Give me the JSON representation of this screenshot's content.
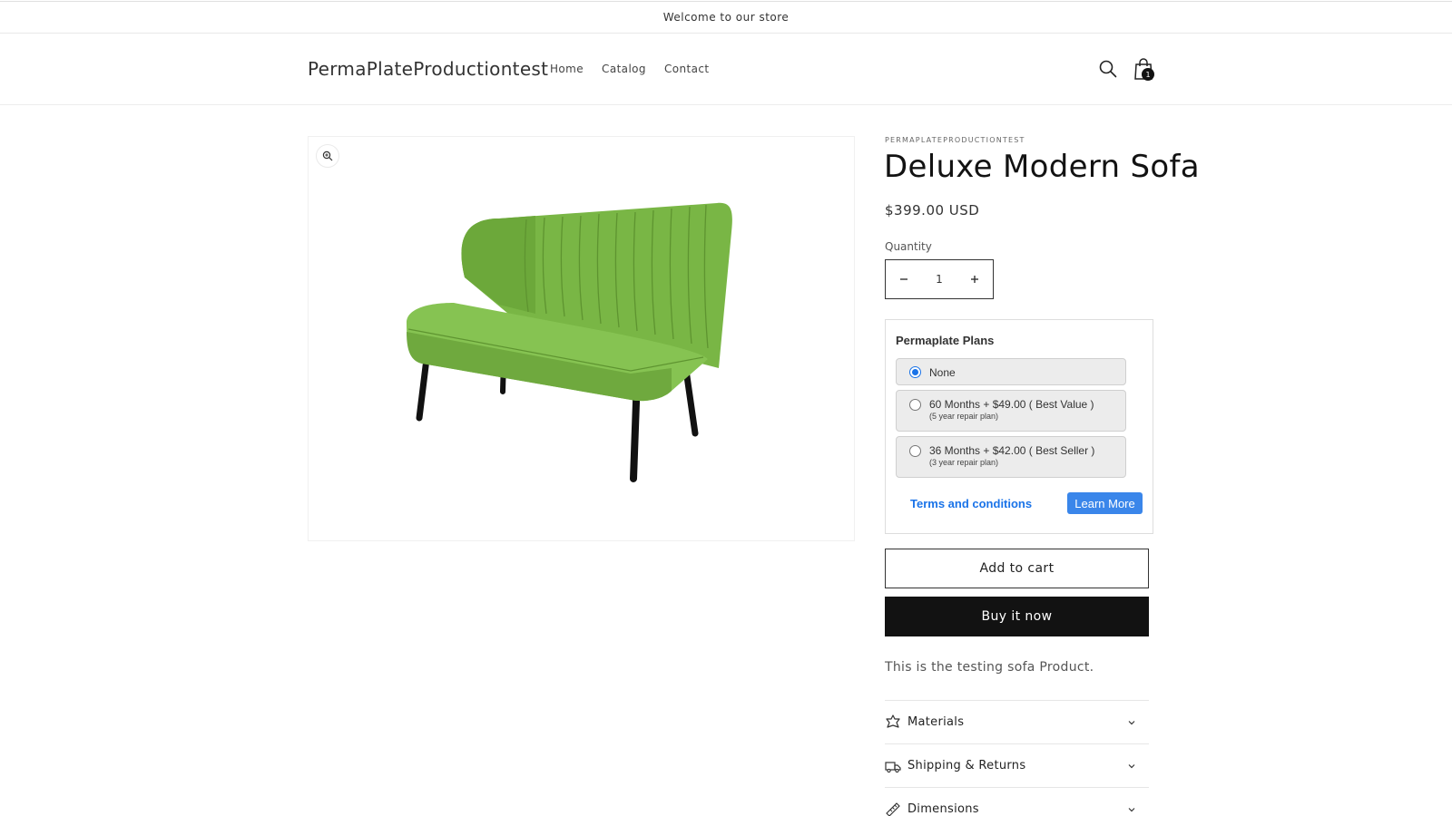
{
  "announcement": {
    "text": "Welcome to our store"
  },
  "header": {
    "logo": "PermaPlateProductiontest",
    "nav": [
      {
        "label": "Home"
      },
      {
        "label": "Catalog"
      },
      {
        "label": "Contact"
      }
    ],
    "cart_count": "1"
  },
  "product": {
    "vendor": "PERMAPLATEPRODUCTIONTEST",
    "title": "Deluxe Modern Sofa",
    "price": "$399.00 USD",
    "quantity_label": "Quantity",
    "quantity_value": "1",
    "description": "This is the testing sofa Product.",
    "image_color": "#7bb848"
  },
  "plans": {
    "title": "Permaplate Plans",
    "options": [
      {
        "label": "None",
        "sub": "",
        "selected": true
      },
      {
        "label": "60 Months + $49.00 ( Best Value )",
        "sub": "(5 year repair plan)",
        "selected": false
      },
      {
        "label": "36 Months + $42.00 ( Best Seller )",
        "sub": "(3 year repair plan)",
        "selected": false
      }
    ],
    "terms_link": "Terms and conditions",
    "learn_more": "Learn More"
  },
  "buttons": {
    "add_to_cart": "Add to cart",
    "buy_now": "Buy it now"
  },
  "accordions": [
    {
      "label": "Materials",
      "icon": "leaf-icon"
    },
    {
      "label": "Shipping & Returns",
      "icon": "truck-icon"
    },
    {
      "label": "Dimensions",
      "icon": "ruler-icon"
    }
  ],
  "colors": {
    "accent_blue": "#1a73e8",
    "button_blue": "#3a86ea",
    "dark": "#121212"
  }
}
